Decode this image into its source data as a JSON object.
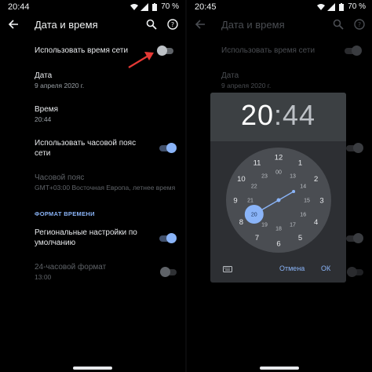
{
  "left": {
    "status": {
      "time": "20:44",
      "battery": "70 %"
    },
    "toolbar": {
      "title": "Дата и время"
    },
    "rows": {
      "network_time": "Использовать время сети",
      "date_title": "Дата",
      "date_value": "9 апреля 2020 г.",
      "time_title": "Время",
      "time_value": "20:44",
      "network_tz": "Использовать часовой пояс сети",
      "tz_title": "Часовой пояс",
      "tz_value": "GMT+03:00 Восточная Европа, летнее время",
      "section": "ФОРМАТ ВРЕМЕНИ",
      "regional": "Региональные настройки по умолчанию",
      "format24_title": "24-часовой формат",
      "format24_value": "13:00"
    },
    "switches": {
      "network_time": "off",
      "network_tz": "on",
      "regional": "on",
      "format24": "disabled"
    }
  },
  "right": {
    "status": {
      "time": "20:45",
      "battery": "70 %"
    },
    "toolbar": {
      "title": "Дата и время"
    },
    "rows": {
      "network_time": "Использовать время сети",
      "date_title": "Дата",
      "date_value": "9 апреля 2020 г."
    },
    "dialog": {
      "hours": "20",
      "separator": ":",
      "minutes": "44",
      "cancel": "Отмена",
      "ok": "ОК",
      "outer_numbers": [
        "12",
        "1",
        "2",
        "3",
        "4",
        "5",
        "6",
        "7",
        "8",
        "9",
        "10",
        "11"
      ],
      "inner_numbers": [
        "00",
        "13",
        "14",
        "15",
        "16",
        "17",
        "18",
        "19",
        "20",
        "21",
        "22",
        "23"
      ],
      "selected": "20"
    }
  },
  "colors": {
    "accent": "#8ab4f8",
    "arrow": "#e53935"
  }
}
